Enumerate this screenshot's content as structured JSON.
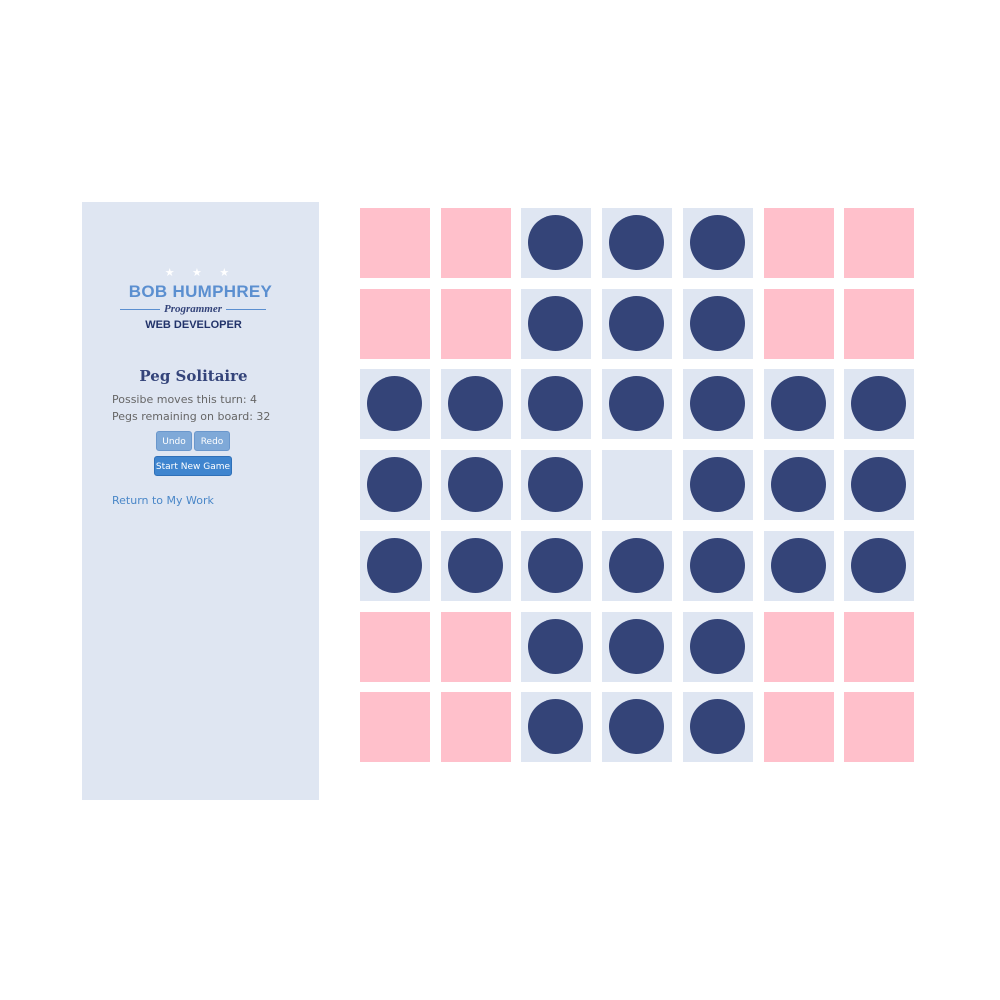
{
  "logo": {
    "stars": "★ ★ ★",
    "name": "BOB HUMPHREY",
    "subtitle": "Programmer",
    "role": "WEB DEVELOPER"
  },
  "game": {
    "title": "Peg Solitaire",
    "moves_text": "Possibe moves this turn: 4",
    "pegs_text": "Pegs remaining on board: 32",
    "undo_label": "Undo",
    "redo_label": "Redo",
    "new_game_label": "Start New Game",
    "return_link": "Return to My Work"
  },
  "board": {
    "rows": [
      [
        null,
        null,
        1,
        1,
        1,
        null,
        null
      ],
      [
        null,
        null,
        1,
        1,
        1,
        null,
        null
      ],
      [
        1,
        1,
        1,
        1,
        1,
        1,
        1
      ],
      [
        1,
        1,
        1,
        0,
        1,
        1,
        1
      ],
      [
        1,
        1,
        1,
        1,
        1,
        1,
        1
      ],
      [
        null,
        null,
        1,
        1,
        1,
        null,
        null
      ],
      [
        null,
        null,
        1,
        1,
        1,
        null,
        null
      ]
    ]
  },
  "colors": {
    "corner": "#ffc0cb",
    "hole": "#dfe6f2",
    "peg": "#344478",
    "panel": "#dfe6f2",
    "accent": "#3f85cf"
  }
}
